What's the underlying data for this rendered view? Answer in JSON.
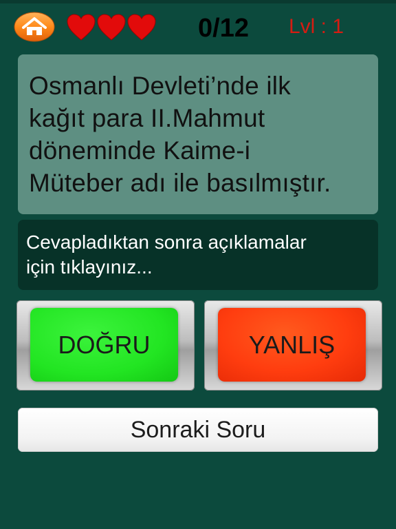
{
  "header": {
    "home_icon": "home-icon",
    "lives": {
      "count": 3,
      "icon": "heart-icon",
      "color": "#e20b0b"
    },
    "score": "0/12",
    "level": "Lvl : 1"
  },
  "question": {
    "lines": [
      "Osmanlı Devleti’nde ilk",
      "kağıt para II.Mahmut",
      "döneminde Kaime-i",
      "Müteber adı ile basılmıştır."
    ]
  },
  "explanation": {
    "lines": [
      "Cevapladıktan sonra açıklamalar",
      "için tıklayınız..."
    ]
  },
  "answers": {
    "true_label": "DOĞRU",
    "false_label": "YANLIŞ"
  },
  "next_label": "Sonraki Soru",
  "colors": {
    "background": "#0c4a3d",
    "question_card": "#5e8f82",
    "explanation_card": "#073228",
    "true_button": "#22e522",
    "false_button": "#ff3d0f",
    "level_text": "#d61c12"
  }
}
